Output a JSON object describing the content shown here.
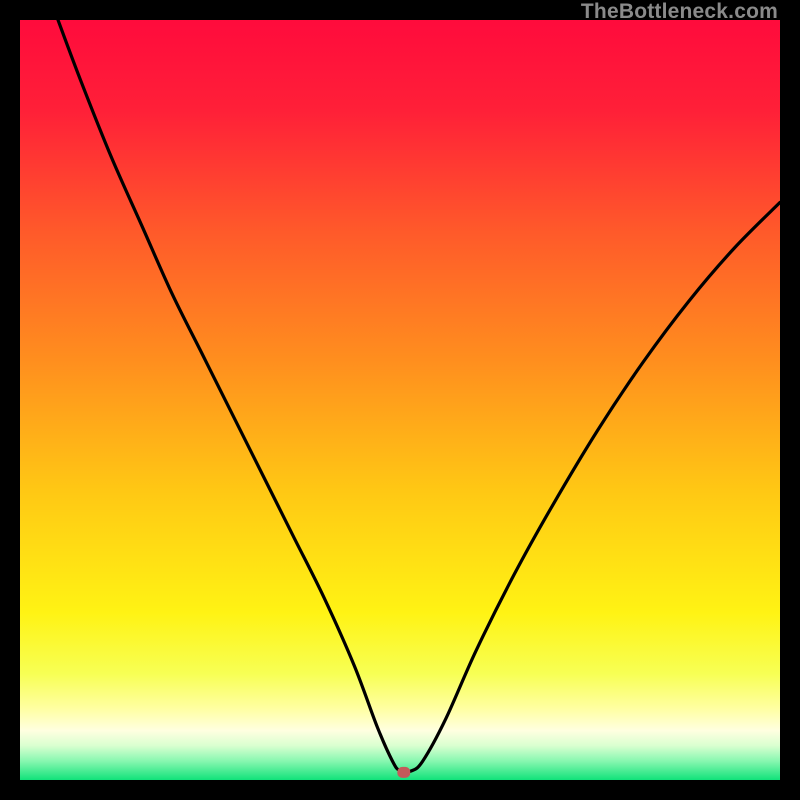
{
  "watermark": "TheBottleneck.com",
  "colors": {
    "background": "#000000",
    "gradient_stops": [
      {
        "offset": 0.0,
        "color": "#ff0b3c"
      },
      {
        "offset": 0.12,
        "color": "#ff2038"
      },
      {
        "offset": 0.28,
        "color": "#ff5a2a"
      },
      {
        "offset": 0.45,
        "color": "#ff8f1e"
      },
      {
        "offset": 0.62,
        "color": "#ffc814"
      },
      {
        "offset": 0.78,
        "color": "#fff314"
      },
      {
        "offset": 0.86,
        "color": "#f7ff54"
      },
      {
        "offset": 0.905,
        "color": "#ffffa0"
      },
      {
        "offset": 0.935,
        "color": "#ffffe0"
      },
      {
        "offset": 0.955,
        "color": "#d9ffd0"
      },
      {
        "offset": 0.975,
        "color": "#88f7b0"
      },
      {
        "offset": 1.0,
        "color": "#11e27a"
      }
    ],
    "curve_stroke": "#000000",
    "marker_fill": "#c45a5a"
  },
  "chart_data": {
    "type": "line",
    "title": "",
    "xlabel": "",
    "ylabel": "",
    "xlim": [
      0,
      100
    ],
    "ylim": [
      0,
      100
    ],
    "marker": {
      "x": 50.5,
      "y": 1.0
    },
    "series": [
      {
        "name": "bottleneck-curve",
        "x": [
          5,
          8,
          12,
          16,
          20,
          24,
          28,
          32,
          36,
          40,
          44,
          47,
          49,
          50,
          51.5,
          53,
          56,
          60,
          65,
          70,
          76,
          82,
          88,
          94,
          100
        ],
        "y": [
          100,
          92,
          82,
          73,
          64,
          56,
          48,
          40,
          32,
          24,
          15,
          7,
          2.5,
          1.2,
          1.2,
          2.5,
          8,
          17,
          27,
          36,
          46,
          55,
          63,
          70,
          76
        ]
      }
    ]
  }
}
